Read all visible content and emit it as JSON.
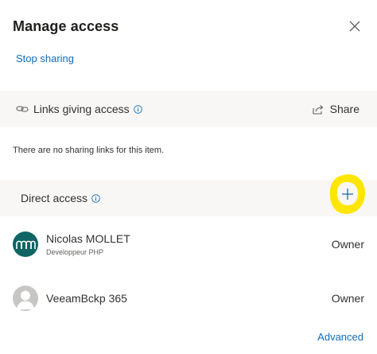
{
  "dialog": {
    "title": "Manage access",
    "close_icon": "close-icon"
  },
  "actions": {
    "stop_sharing_label": "Stop sharing",
    "advanced_label": "Advanced"
  },
  "links_section": {
    "label": "Links giving access",
    "link_icon": "link-icon",
    "info_icon": "info-icon",
    "share_label": "Share",
    "share_icon": "share-icon",
    "empty_message": "There are no sharing links for this item."
  },
  "direct_section": {
    "label": "Direct access",
    "info_icon": "info-icon",
    "add_icon": "plus-icon"
  },
  "people": [
    {
      "name": "Nicolas MOLLET",
      "subtitle": "Developpeur PHP",
      "role": "Owner",
      "avatar": "nm-logo-avatar"
    },
    {
      "name": "VeeamBckp 365",
      "subtitle": "",
      "role": "Owner",
      "avatar": "generic-person-avatar"
    }
  ],
  "colors": {
    "link_blue": "#0f6cbd",
    "section_bg": "#f8f7f5",
    "highlight_yellow": "#ffe600",
    "avatar_teal": "#0f6464"
  }
}
